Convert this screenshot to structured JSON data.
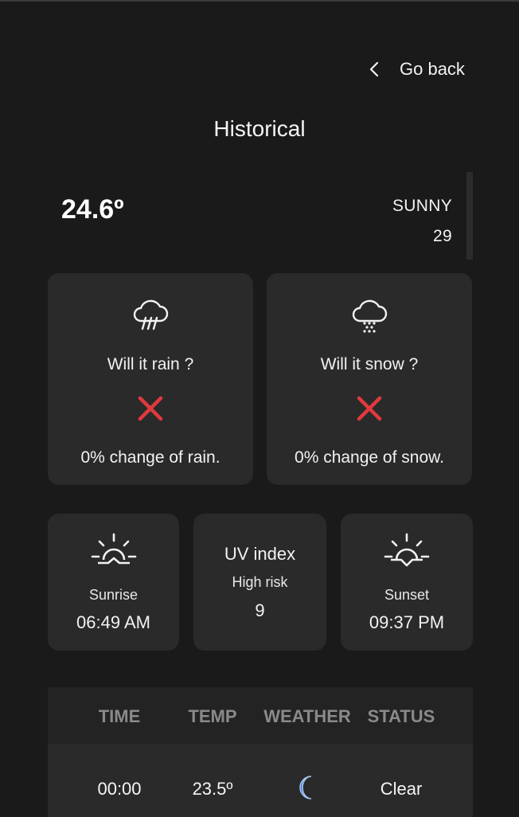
{
  "nav": {
    "back_label": "Go back",
    "back_icon": "chevron-left-icon"
  },
  "page": {
    "title": "Historical"
  },
  "current": {
    "temperature": "24.6º",
    "condition": "SUNNY",
    "value": "29"
  },
  "rain_card": {
    "icon": "rain-cloud-icon",
    "question": "Will it rain ?",
    "answer_icon": "cross-icon",
    "chance_text": "0% change of rain."
  },
  "snow_card": {
    "icon": "snow-cloud-icon",
    "question": "Will it snow ?",
    "answer_icon": "cross-icon",
    "chance_text": "0% change of snow."
  },
  "sunrise": {
    "icon": "sunrise-icon",
    "label": "Sunrise",
    "time": "06:49 AM"
  },
  "uv": {
    "title": "UV index",
    "risk": "High risk",
    "value": "9"
  },
  "sunset": {
    "icon": "sunset-icon",
    "label": "Sunset",
    "time": "09:37 PM"
  },
  "table": {
    "headers": [
      "TIME",
      "TEMP",
      "WEATHER",
      "STATUS"
    ],
    "rows": [
      {
        "time": "00:00",
        "temp": "23.5º",
        "weather_icon": "moon-icon",
        "status": "Clear"
      }
    ]
  },
  "colors": {
    "background": "#1a1a1a",
    "card": "#2a2a2a",
    "cross": "#e0393e",
    "moon": "#3f7fd9",
    "header_text": "#8a8a8a"
  }
}
